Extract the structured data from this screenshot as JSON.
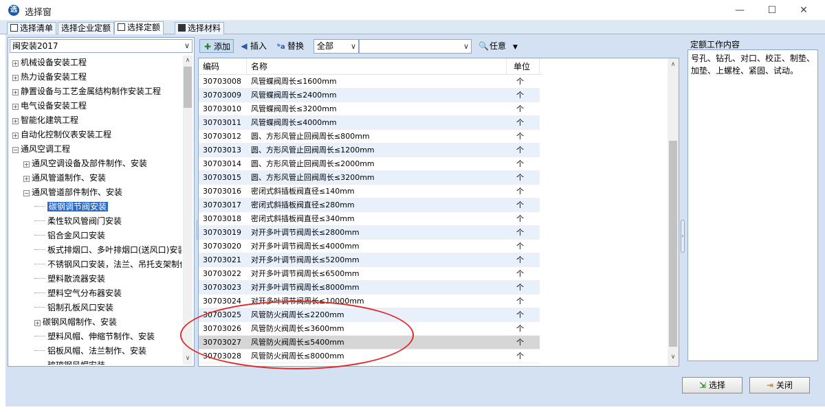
{
  "window": {
    "title": "选择窗",
    "app_icon": "app-logo-icon",
    "controls": [
      "—",
      "☐",
      "✕"
    ]
  },
  "tabs": [
    {
      "label": "选择清单"
    },
    {
      "label": "选择企业定额"
    },
    {
      "label": "选择定额"
    },
    {
      "label": "选择材料"
    }
  ],
  "left": {
    "combo_value": "闽安装2017",
    "tree": [
      {
        "label": "机械设备安装工程",
        "toggle": "+"
      },
      {
        "label": "热力设备安装工程",
        "toggle": "+"
      },
      {
        "label": "静置设备与工艺金属结构制作安装工程",
        "toggle": "+"
      },
      {
        "label": "电气设备安装工程",
        "toggle": "+"
      },
      {
        "label": "智能化建筑工程",
        "toggle": "+"
      },
      {
        "label": "自动化控制仪表安装工程",
        "toggle": "+"
      },
      {
        "label": "通风空调工程",
        "toggle": "−"
      },
      {
        "label": "通风空调设备及部件制作、安装",
        "toggle": "+"
      },
      {
        "label": "通风管道制作、安装",
        "toggle": "+"
      },
      {
        "label": "通风管道部件制作、安装",
        "toggle": "−"
      },
      {
        "label": "碳钢调节阀安装"
      },
      {
        "label": "柔性软风管阀门安装"
      },
      {
        "label": "铝合金风口安装"
      },
      {
        "label": "板式排烟口、多叶排烟口(送风口)安装"
      },
      {
        "label": "不锈钢风口安装，法兰、吊托支架制作"
      },
      {
        "label": "塑料散流器安装"
      },
      {
        "label": "塑料空气分布器安装"
      },
      {
        "label": "铝制孔板风口安装"
      },
      {
        "label": "碳钢风帽制作、安装",
        "toggle": "+"
      },
      {
        "label": "塑料风帽、伸缩节制作、安装"
      },
      {
        "label": "铝板风帽、法兰制作、安装"
      },
      {
        "label": "玻璃钢风帽安装"
      }
    ]
  },
  "toolbar": {
    "add": "添加",
    "insert": "插入",
    "replace": "替换",
    "filter": "全部",
    "search_value": "",
    "any": "任意"
  },
  "grid": {
    "headers": [
      "编码",
      "名称",
      "单位"
    ],
    "rows": [
      {
        "code": "30703008",
        "name": "风管蝶阀周长≤1600mm",
        "unit": "个"
      },
      {
        "code": "30703009",
        "name": "风管蝶阀周长≤2400mm",
        "unit": "个"
      },
      {
        "code": "30703010",
        "name": "风管蝶阀周长≤3200mm",
        "unit": "个"
      },
      {
        "code": "30703011",
        "name": "风管蝶阀周长≤4000mm",
        "unit": "个"
      },
      {
        "code": "30703012",
        "name": "圆、方形风管止回阀周长≤800mm",
        "unit": "个"
      },
      {
        "code": "30703013",
        "name": "圆、方形风管止回阀周长≤1200mm",
        "unit": "个"
      },
      {
        "code": "30703014",
        "name": "圆、方形风管止回阀周长≤2000mm",
        "unit": "个"
      },
      {
        "code": "30703015",
        "name": "圆、方形风管止回阀周长≤3200mm",
        "unit": "个"
      },
      {
        "code": "30703016",
        "name": "密闭式斜插板阀直径≤140mm",
        "unit": "个"
      },
      {
        "code": "30703017",
        "name": "密闭式斜插板阀直径≤280mm",
        "unit": "个"
      },
      {
        "code": "30703018",
        "name": "密闭式斜插板阀直径≤340mm",
        "unit": "个"
      },
      {
        "code": "30703019",
        "name": "对开多叶调节阀周长≤2800mm",
        "unit": "个"
      },
      {
        "code": "30703020",
        "name": "对开多叶调节阀周长≤4000mm",
        "unit": "个"
      },
      {
        "code": "30703021",
        "name": "对开多叶调节阀周长≤5200mm",
        "unit": "个"
      },
      {
        "code": "30703022",
        "name": "对开多叶调节阀周长≤6500mm",
        "unit": "个"
      },
      {
        "code": "30703023",
        "name": "对开多叶调节阀周长≤8000mm",
        "unit": "个"
      },
      {
        "code": "30703024",
        "name": "对开多叶调节阀周长≤10000mm",
        "unit": "个"
      },
      {
        "code": "30703025",
        "name": "风管防火阀周长≤2200mm",
        "unit": "个"
      },
      {
        "code": "30703026",
        "name": "风管防火阀周长≤3600mm",
        "unit": "个"
      },
      {
        "code": "30703027",
        "name": "风管防火阀周长≤5400mm",
        "unit": "个"
      },
      {
        "code": "30703028",
        "name": "风管防火阀周长≤8000mm",
        "unit": "个"
      }
    ]
  },
  "right": {
    "title": "定额工作内容",
    "content": "号孔、钻孔、对口、校正、制垫、加垫、上螺栓、紧固、试动。"
  },
  "buttons": {
    "select": "选择",
    "close": "关闭"
  },
  "colors": {
    "panel_bg": "#d3e1f2",
    "selected_tree": "#2d6ac7",
    "annotation": "#e02a2a"
  }
}
